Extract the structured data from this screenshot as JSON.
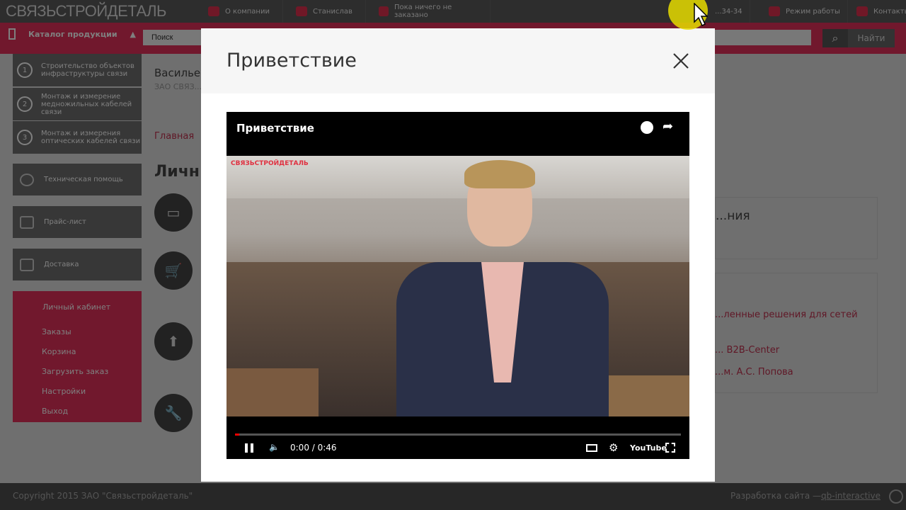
{
  "topbar": {
    "logo": "СВЯЗЬСТРОЙДЕТАЛЬ",
    "items": [
      "О компании",
      "Станислав",
      "Пока ничего не заказано"
    ],
    "phone": "...34-34",
    "hours": "Режим работы",
    "contacts": "Контакты"
  },
  "searchbar": {
    "catalog": "Каталог продукции",
    "placeholder": "Поиск",
    "find": "Найти"
  },
  "sidebar": {
    "courses": [
      {
        "num": "1",
        "label": "Строительство объектов инфраструктуры связи"
      },
      {
        "num": "2",
        "label": "Монтаж и измерение медножильных кабелей связи"
      },
      {
        "num": "3",
        "label": "Монтаж и измерения оптических кабелей связи"
      }
    ],
    "links": [
      "Техническая помощь",
      "Прайс-лист",
      "Доставка"
    ],
    "cabinet": {
      "title": "Личный кабинет",
      "items": [
        "Заказы",
        "Корзина",
        "Загрузить заказ",
        "Настройки",
        "Выход"
      ]
    }
  },
  "main": {
    "user": "Васильев",
    "company": "ЗАО СВЯЗ...",
    "breadcrumb": "Главная",
    "heading": "Личн...",
    "panel_title": "...ния",
    "links": [
      "...ленные решения для сетей",
      "... B2B-Center",
      "...м. А.С. Попова"
    ]
  },
  "footer": {
    "copyright": "Copyright 2015 ЗАО \"Связьстройдеталь\"",
    "dev_label": "Разработка сайта —",
    "dev_link": "qb-interactive"
  },
  "modal": {
    "title": "Приветствие",
    "video": {
      "title": "Приветствие",
      "watermark": "СВЯЗЬСТРОЙДЕТАЛЬ",
      "time": "0:00 / 0:46",
      "progress": 0.01,
      "youtube": "YouTube"
    }
  }
}
